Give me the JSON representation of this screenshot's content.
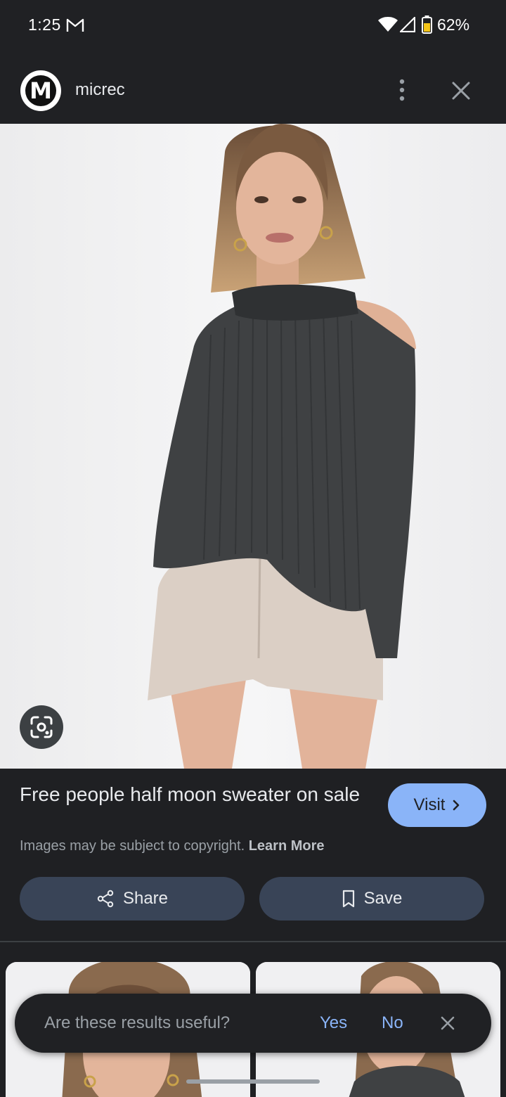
{
  "status_bar": {
    "time": "1:25",
    "battery": "62%",
    "icons": [
      "gmail-icon",
      "wifi-icon",
      "signal-icon",
      "battery-icon"
    ]
  },
  "header": {
    "avatar_letter": "M",
    "site_name": "micrec",
    "icons": [
      "more-vert-icon",
      "close-icon"
    ]
  },
  "image": {
    "alt": "Woman wearing charcoal ribbed cold-shoulder sweater and beige shorts"
  },
  "info": {
    "title": "Free people half moon sweater on sale",
    "visit_label": "Visit",
    "copyright_text": "Images may be subject to copyright.",
    "learn_more": "Learn More"
  },
  "actions": {
    "share_label": "Share",
    "save_label": "Save"
  },
  "snackbar": {
    "question": "Are these results useful?",
    "yes_label": "Yes",
    "no_label": "No"
  },
  "colors": {
    "background": "#1f2023",
    "accent": "#8ab4f8",
    "button_bg": "#394457",
    "secondary_text": "#9aa0a6"
  }
}
